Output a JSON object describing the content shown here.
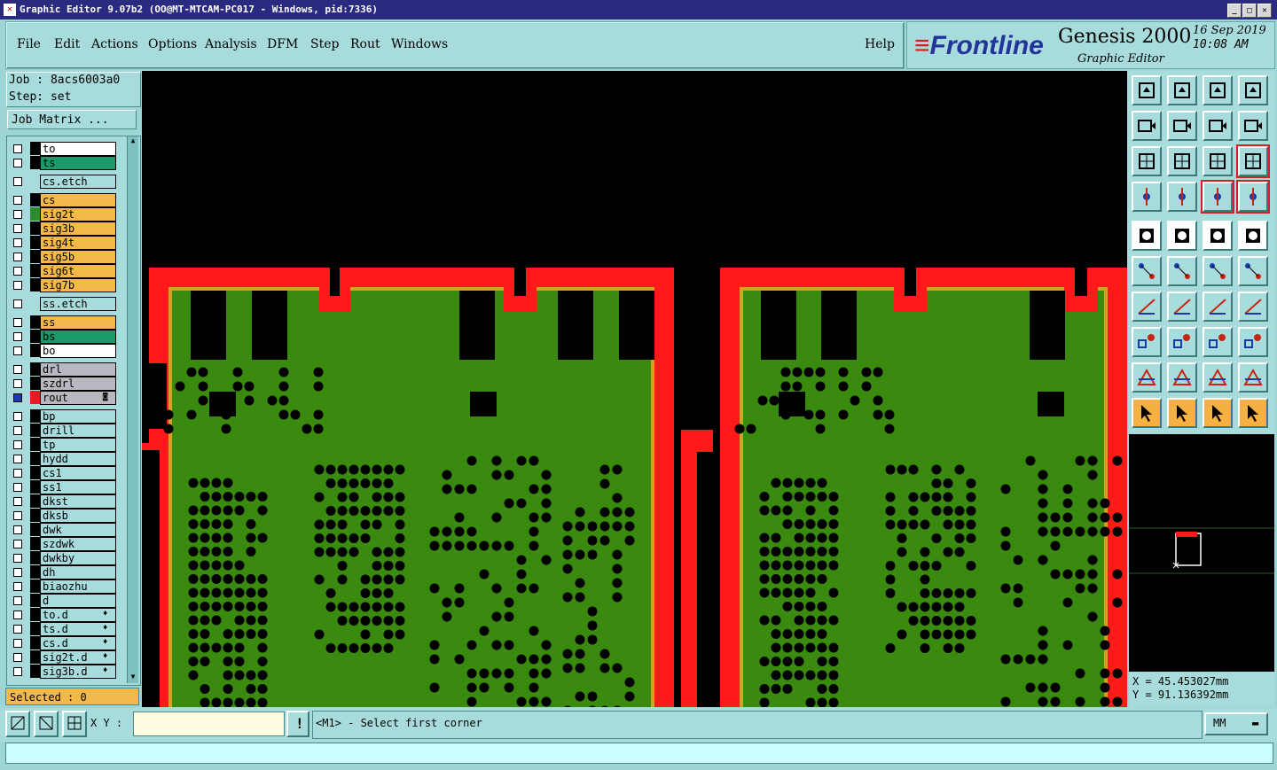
{
  "window": {
    "title": "Graphic Editor 9.07b2 (OO@MT-MTCAM-PC017 - Windows, pid:7336)"
  },
  "menu": {
    "items": [
      "File",
      "Edit",
      "Actions",
      "Options",
      "Analysis",
      "DFM",
      "Step",
      "Rout",
      "Windows"
    ],
    "help": "Help"
  },
  "branding": {
    "logo": "Frontline",
    "product": "Genesis 2000",
    "module": "Graphic Editor",
    "date": "16 Sep 2019",
    "time": "10:08 AM"
  },
  "job": {
    "job_label": "Job : 8acs6003a0",
    "step_label": "Step: set",
    "matrix_button": "Job Matrix ..."
  },
  "layers": [
    {
      "name": "to",
      "color": "#ffffff",
      "swatch": "#000000"
    },
    {
      "name": "ts",
      "color": "#1a9a6a",
      "swatch": "#000000"
    },
    {
      "name": "cs.etch",
      "color": "#a8dcdc",
      "swatch": "#a8dcdc",
      "gap": true
    },
    {
      "name": "cs",
      "color": "#f5b94a",
      "swatch": "#000000",
      "gap": true
    },
    {
      "name": "sig2t",
      "color": "#f5b94a",
      "swatch": "#2e8b2e"
    },
    {
      "name": "sig3b",
      "color": "#f5b94a",
      "swatch": "#000000"
    },
    {
      "name": "sig4t",
      "color": "#f5b94a",
      "swatch": "#000000"
    },
    {
      "name": "sig5b",
      "color": "#f5b94a",
      "swatch": "#000000"
    },
    {
      "name": "sig6t",
      "color": "#f5b94a",
      "swatch": "#000000"
    },
    {
      "name": "sig7b",
      "color": "#f5b94a",
      "swatch": "#000000"
    },
    {
      "name": "ss.etch",
      "color": "#a8dcdc",
      "swatch": "#a8dcdc",
      "gap": true
    },
    {
      "name": "ss",
      "color": "#f5b94a",
      "swatch": "#000000",
      "gap": true
    },
    {
      "name": "bs",
      "color": "#1a9a6a",
      "swatch": "#000000"
    },
    {
      "name": "bo",
      "color": "#ffffff",
      "swatch": "#000000"
    },
    {
      "name": "drl",
      "color": "#b8b8c0",
      "swatch": "#000000",
      "gap": true
    },
    {
      "name": "szdrl",
      "color": "#b8b8c0",
      "swatch": "#000000"
    },
    {
      "name": "rout",
      "color": "#b8b8c0",
      "swatch": "#e02020",
      "active": true,
      "mark": "◙"
    },
    {
      "name": "bp",
      "color": "#a8dcdc",
      "swatch": "#000000",
      "gap": true
    },
    {
      "name": "drill",
      "color": "#a8dcdc",
      "swatch": "#000000"
    },
    {
      "name": "tp",
      "color": "#a8dcdc",
      "swatch": "#000000"
    },
    {
      "name": "hydd",
      "color": "#a8dcdc",
      "swatch": "#000000"
    },
    {
      "name": "cs1",
      "color": "#a8dcdc",
      "swatch": "#000000"
    },
    {
      "name": "ss1",
      "color": "#a8dcdc",
      "swatch": "#000000"
    },
    {
      "name": "dkst",
      "color": "#a8dcdc",
      "swatch": "#000000"
    },
    {
      "name": "dksb",
      "color": "#a8dcdc",
      "swatch": "#000000"
    },
    {
      "name": "dwk",
      "color": "#a8dcdc",
      "swatch": "#000000"
    },
    {
      "name": "szdwk",
      "color": "#a8dcdc",
      "swatch": "#000000"
    },
    {
      "name": "dwkby",
      "color": "#a8dcdc",
      "swatch": "#000000"
    },
    {
      "name": "dh",
      "color": "#a8dcdc",
      "swatch": "#000000"
    },
    {
      "name": "biaozhu",
      "color": "#a8dcdc",
      "swatch": "#000000"
    },
    {
      "name": "d",
      "color": "#a8dcdc",
      "swatch": "#000000"
    },
    {
      "name": "to.d",
      "color": "#a8dcdc",
      "swatch": "#000000",
      "mark": "♦"
    },
    {
      "name": "ts.d",
      "color": "#a8dcdc",
      "swatch": "#000000",
      "mark": "♦"
    },
    {
      "name": "cs.d",
      "color": "#a8dcdc",
      "swatch": "#000000",
      "mark": "♦"
    },
    {
      "name": "sig2t.d",
      "color": "#a8dcdc",
      "swatch": "#000000",
      "mark": "♦"
    },
    {
      "name": "sig3b.d",
      "color": "#a8dcdc",
      "swatch": "#000000",
      "mark": "♦"
    }
  ],
  "selection": {
    "label": "Selected : 0"
  },
  "coords": {
    "x_label": "X = 45.453027mm",
    "y_label": "Y = 91.136392mm"
  },
  "bottom": {
    "xy_label": "X Y :",
    "xy_value": "",
    "prompt": "<M1> - Select first corner",
    "units": "MM"
  },
  "colors": {
    "board": "#3a8a10",
    "rout": "#ff1a1a",
    "edge": "#d8a020",
    "canvas_bg": "#000000"
  }
}
